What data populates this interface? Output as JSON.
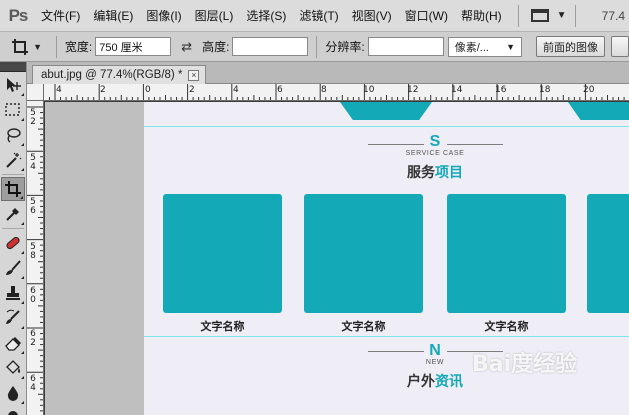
{
  "app": {
    "logo": "Ps",
    "zoom_readout": "77.4"
  },
  "menu": {
    "items": [
      {
        "label": "文件(F)"
      },
      {
        "label": "编辑(E)"
      },
      {
        "label": "图像(I)"
      },
      {
        "label": "图层(L)"
      },
      {
        "label": "选择(S)"
      },
      {
        "label": "滤镜(T)"
      },
      {
        "label": "视图(V)"
      },
      {
        "label": "窗口(W)"
      },
      {
        "label": "帮助(H)"
      }
    ]
  },
  "options": {
    "width_label": "宽度:",
    "width_value": "750 厘米",
    "height_label": "高度:",
    "height_value": "",
    "resolution_label": "分辨率:",
    "resolution_value": "",
    "unit_select": "像素/...",
    "front_image_button": "前面的图像"
  },
  "document": {
    "tab_title": "abut.jpg @ 77.4%(RGB/8) *",
    "close_glyph": "×"
  },
  "rulers": {
    "top": [
      "4",
      "2",
      "0",
      "2",
      "4",
      "6",
      "8",
      "10",
      "12",
      "14",
      "16",
      "18",
      "20"
    ],
    "left": [
      "5\n2",
      "5\n4",
      "5\n6",
      "5\n8",
      "6\n0",
      "6\n2",
      "6\n4"
    ]
  },
  "canvas": {
    "accent_color": "#14a9b7",
    "section1": {
      "letter": "S",
      "subtitle": "SERVICE CASE",
      "title_plain": "服务",
      "title_accent": "项目"
    },
    "cards": [
      {
        "label": "文字名称"
      },
      {
        "label": "文字名称"
      },
      {
        "label": "文字名称"
      },
      {
        "label": ""
      }
    ],
    "section2": {
      "letter": "N",
      "subtitle": "NEW",
      "title_plain": "户外",
      "title_accent": "资讯"
    }
  },
  "watermark": "Bai度经验"
}
